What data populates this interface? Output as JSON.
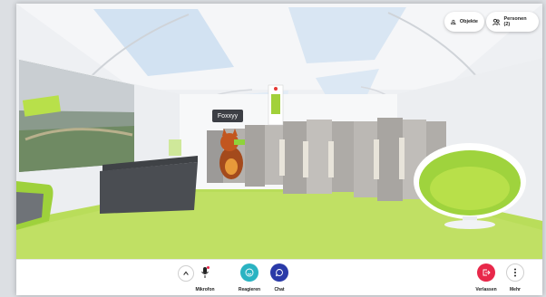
{
  "header": {
    "objects_label": "Objekte",
    "persons_label": "Personen (2)"
  },
  "scene": {
    "avatar_name": "Foxxyy",
    "icons": {
      "objects": "shapes-icon",
      "persons": "people-icon",
      "expand": "chevron-up-icon",
      "mic": "microphone-muted-icon",
      "react": "smiley-icon",
      "chat": "chat-bubble-icon",
      "leave": "exit-icon",
      "more": "more-vertical-icon"
    }
  },
  "toolbar": {
    "mic_label": "Mikrofon",
    "react_label": "Reagieren",
    "chat_label": "Chat",
    "leave_label": "Verlassen",
    "more_label": "Mehr"
  },
  "colors": {
    "react": "#2ab3c2",
    "chat": "#2a3aa8",
    "leave": "#e8284a",
    "floor": "#b9dd5a",
    "ceiling": "#f2f4f6"
  }
}
